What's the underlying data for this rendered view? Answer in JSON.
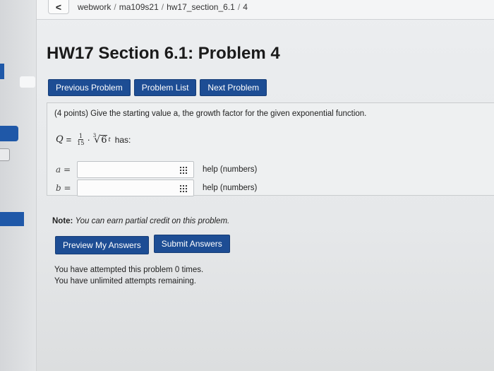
{
  "breadcrumb": {
    "back": "<",
    "items": [
      "webwork",
      "ma109s21",
      "hw17_section_6.1",
      "4"
    ]
  },
  "title": "HW17 Section 6.1: Problem 4",
  "nav": {
    "previous": "Previous Problem",
    "list": "Problem List",
    "next": "Next Problem"
  },
  "problem": {
    "statement": "(4 points) Give the starting value a, the growth factor for the given exponential function.",
    "formula": {
      "var": "Q",
      "eq": "=",
      "frac_num": "1",
      "frac_den": "15",
      "dot": "·",
      "root_index": "3",
      "root_arg": "6",
      "exp": "t",
      "suffix": "has:"
    },
    "answers": [
      {
        "label": "a =",
        "value": "",
        "help": "help (numbers)"
      },
      {
        "label": "b =",
        "value": "",
        "help": "help (numbers)"
      }
    ]
  },
  "note": {
    "bold": "Note:",
    "text": "You can earn partial credit on this problem."
  },
  "actions": {
    "preview": "Preview My Answers",
    "submit": "Submit Answers"
  },
  "attempts": {
    "line1": "You have attempted this problem 0 times.",
    "line2": "You have unlimited attempts remaining."
  },
  "colors": {
    "button": "#1d4d94",
    "background": "#e9ebed"
  }
}
